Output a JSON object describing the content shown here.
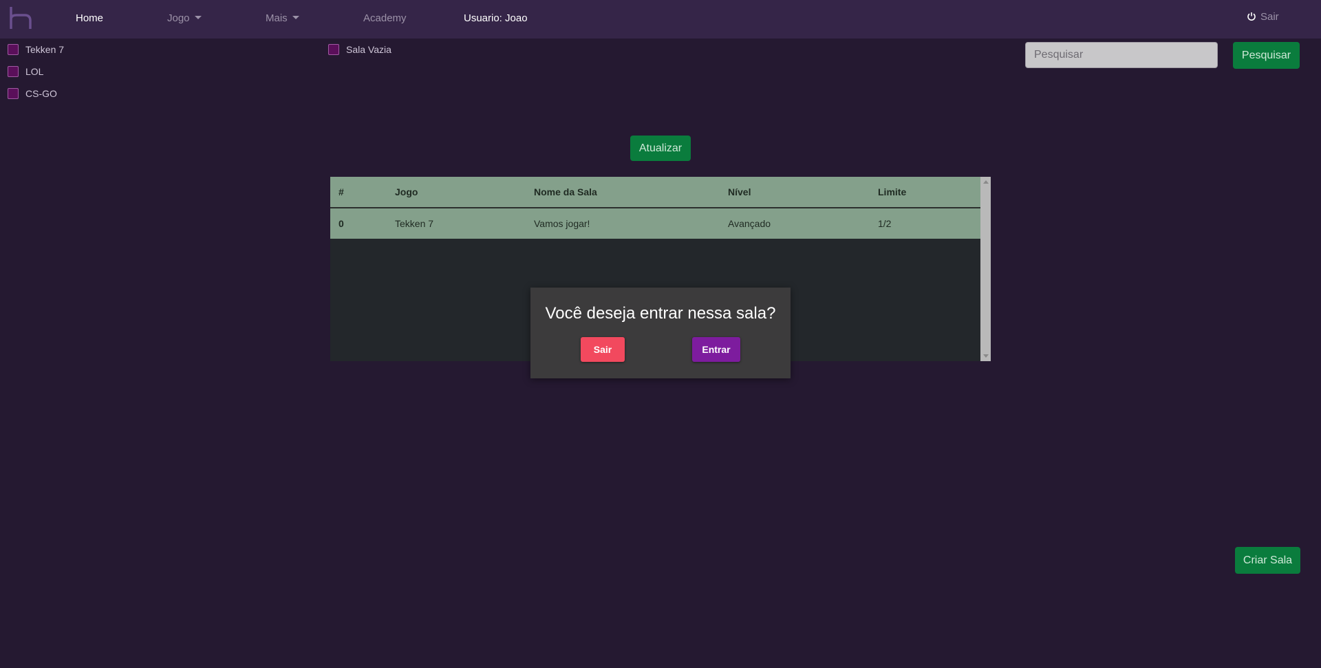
{
  "nav": {
    "home": "Home",
    "jogo": "Jogo",
    "mais": "Mais",
    "academy": "Academy",
    "user": "Usuario: Joao",
    "logout": "Sair"
  },
  "filters": {
    "games": [
      "Tekken 7",
      "LOL",
      "CS-GO"
    ],
    "empty_room": "Sala Vazia"
  },
  "search": {
    "placeholder": "Pesquisar",
    "button": "Pesquisar"
  },
  "refresh_button": "Atualizar",
  "table": {
    "headers": [
      "#",
      "Jogo",
      "Nome da Sala",
      "Nível",
      "Limite"
    ],
    "rows": [
      [
        "0",
        "Tekken 7",
        "Vamos jogar!",
        "Avançado",
        "1/2"
      ]
    ]
  },
  "modal": {
    "title": "Você deseja entrar nessa sala?",
    "cancel": "Sair",
    "confirm": "Entrar"
  },
  "create_button": "Criar Sala",
  "colors": {
    "background": "#251931",
    "navbar": "#352548",
    "green_button": "#0a7c3d",
    "table_row": "#84a08b",
    "modal_bg": "#3c3b3c",
    "cancel_button": "#f2495e",
    "confirm_button": "#7d1c9e"
  }
}
